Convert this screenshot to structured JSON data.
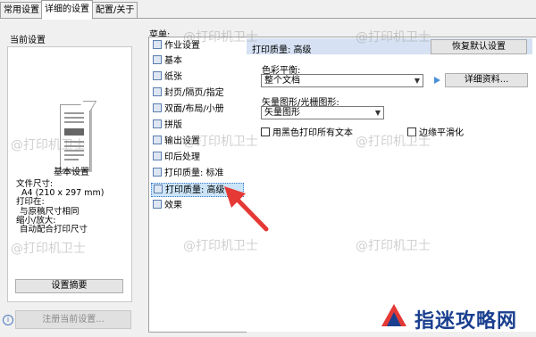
{
  "tabs": [
    "常用设置",
    "详细的设置",
    "配置/关于"
  ],
  "left": {
    "current_settings": "当前设置",
    "basic_settings": "基本设置",
    "file_size_label": "文件尺寸:",
    "file_size_value": "A4 (210 x 297 mm)",
    "print_on_label": "打印在:",
    "print_on_value": "与原稿尺寸相同",
    "scale_label": "缩小/放大:",
    "scale_value": "自动配合打印尺寸",
    "summary_button": "设置摘要",
    "register_button": "注册当前设置..."
  },
  "menu": {
    "label": "菜单:",
    "items": [
      "作业设置",
      "基本",
      "纸张",
      "封页/隔页/指定",
      "双面/布局/小册",
      "拼版",
      "输出设置",
      "印后处理",
      "打印质量: 标准",
      "打印质量: 高级",
      "效果"
    ],
    "selected_index": 9
  },
  "content": {
    "title": "打印质量: 高级",
    "restore_button": "恢复默认设置",
    "color_balance_label": "色彩平衡:",
    "color_balance_value": "整个文档",
    "details_button": "详细资料...",
    "vector_label": "矢量图形/光栅图形:",
    "vector_value": "矢量图形",
    "black_text_label": "用黑色打印所有文本",
    "edge_smooth_label": "边缘平滑化"
  },
  "watermark": "@打印机卫士",
  "logo": "指迷攻略网"
}
